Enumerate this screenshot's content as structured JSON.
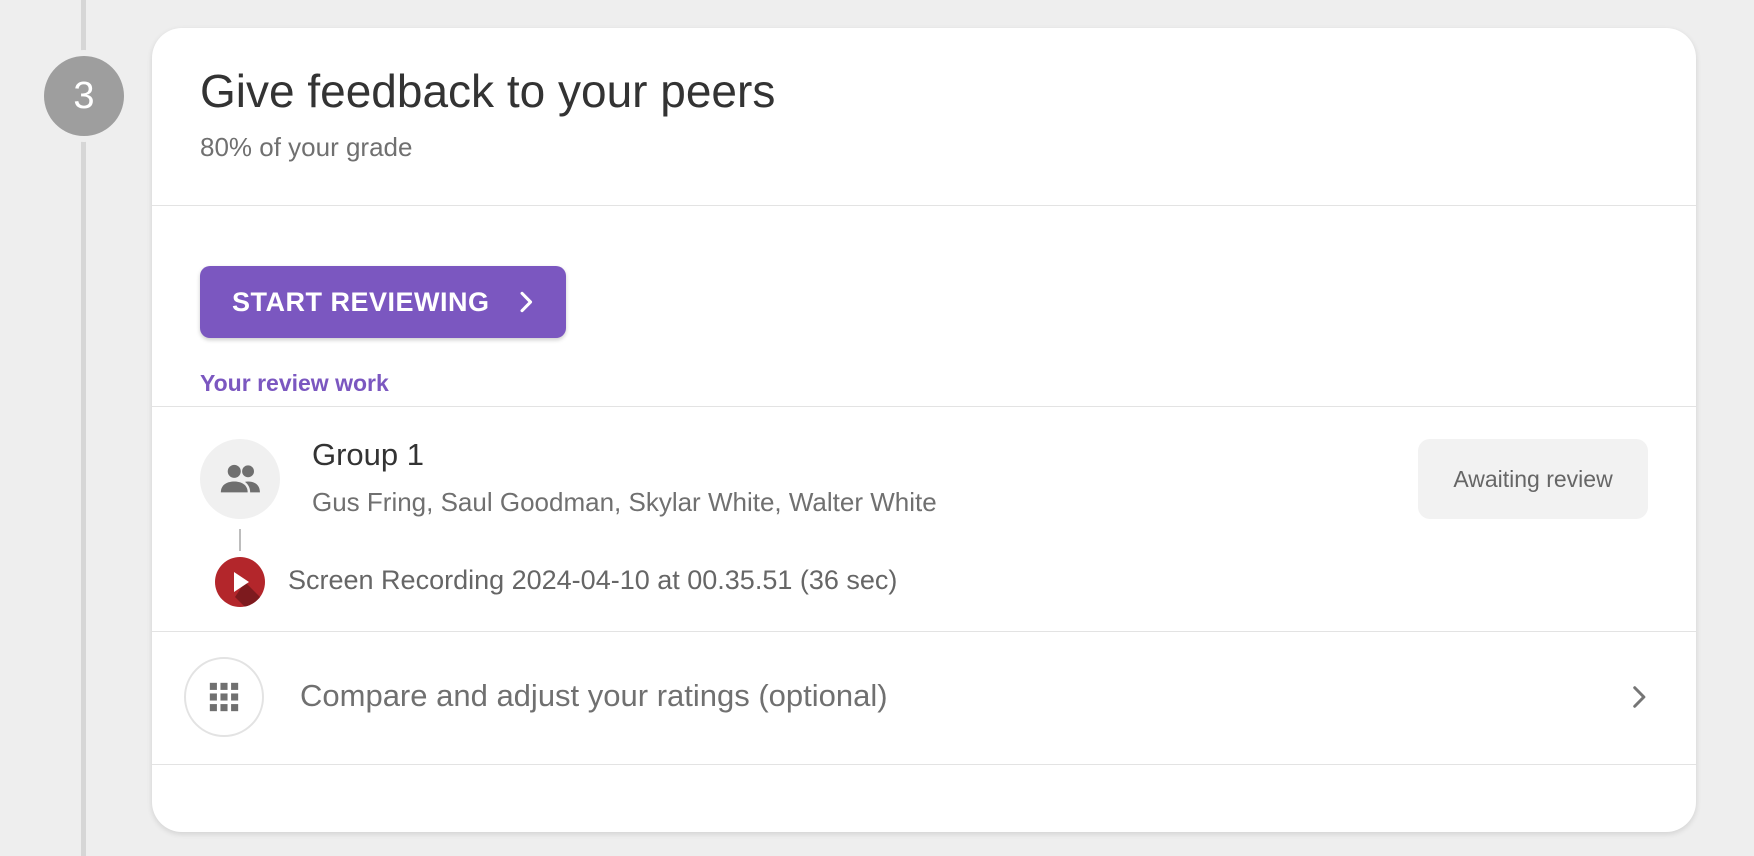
{
  "step": {
    "number": "3"
  },
  "section": {
    "title": "Give feedback to your peers",
    "subtitle": "80% of your grade"
  },
  "actions": {
    "start_label": "START REVIEWING",
    "review_work_link": "Your review work"
  },
  "group": {
    "name": "Group 1",
    "members": "Gus Fring, Saul Goodman, Skylar White, Walter White",
    "status": "Awaiting review",
    "submission": {
      "title": "Screen Recording 2024-04-10 at 00.35.51 (36 sec)"
    }
  },
  "compare": {
    "label": "Compare and adjust your ratings (optional)"
  },
  "colors": {
    "accent": "#7b57c0",
    "step_circle": "#9e9e9e",
    "recording_red": "#b3262b",
    "page_background": "#eeeeee"
  },
  "icons": {
    "group": "group-people-icon",
    "recording": "video-play-icon",
    "compare": "grid-apps-icon",
    "chevron": "chevron-right-icon"
  }
}
